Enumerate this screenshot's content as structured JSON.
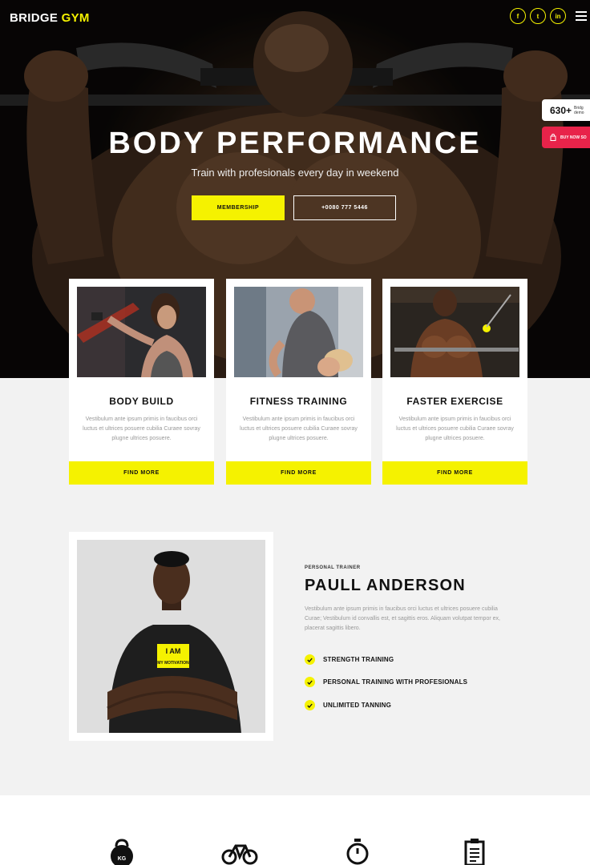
{
  "header": {
    "logo_main": "BRIDGE",
    "logo_accent": "GYM",
    "socials": [
      {
        "name": "facebook",
        "glyph": "f"
      },
      {
        "name": "twitter",
        "glyph": "t"
      },
      {
        "name": "linkedin",
        "glyph": "in"
      }
    ]
  },
  "hero": {
    "title": "BODY PERFORMANCE",
    "subtitle": "Train with profesionals every day in weekend",
    "primary_button": "MEMBERSHIP",
    "secondary_button": "+0080 777 5446"
  },
  "side_widget": {
    "count": "630+",
    "count_caption": "Bridg demo",
    "buy_label": "BUY NOW SO"
  },
  "services": [
    {
      "title": "BODY BUILD",
      "description": "Vestibulum ante ipsum primis in faucibus orci luctus et ultrices posuere cubilia Curaee sovray plugne ultrices posuere.",
      "button": "FIND MORE"
    },
    {
      "title": "FITNESS TRAINING",
      "description": "Vestibulum ante ipsum primis in faucibus orci luctus et ultrices posuere cubilia Curaee sovray plugne ultrices posuere.",
      "button": "FIND MORE"
    },
    {
      "title": "FASTER EXERCISE",
      "description": "Vestibulum ante ipsum primis in faucibus orci luctus et ultrices posuere cubilia Curaee sovray plugne ultrices posuere.",
      "button": "FIND MORE"
    }
  ],
  "trainer": {
    "label": "PERSONAL TRAINER",
    "name": "PAULL ANDERSON",
    "description": "Vestibulum ante ipsum primis in faucibus orci luctus et ultrices posuere cubilia Curae; Vestibulum id convallis est, et sagittis eros. Aliquam volutpat tempor ex, placerat sagittis libero.",
    "shirt_text": "I AM MY MOTIVATION",
    "features": [
      "STRENGTH TRAINING",
      "PERSONAL TRAINING WITH PROFESIONALS",
      "UNLIMITED TANNING"
    ]
  },
  "bottom_icons": [
    "kettlebell-icon",
    "bicycle-icon",
    "stopwatch-icon",
    "clipboard-icon"
  ],
  "kettlebell_label": "KG",
  "colors": {
    "accent": "#f5f200",
    "buy": "#e8234a",
    "dark": "#111111"
  }
}
